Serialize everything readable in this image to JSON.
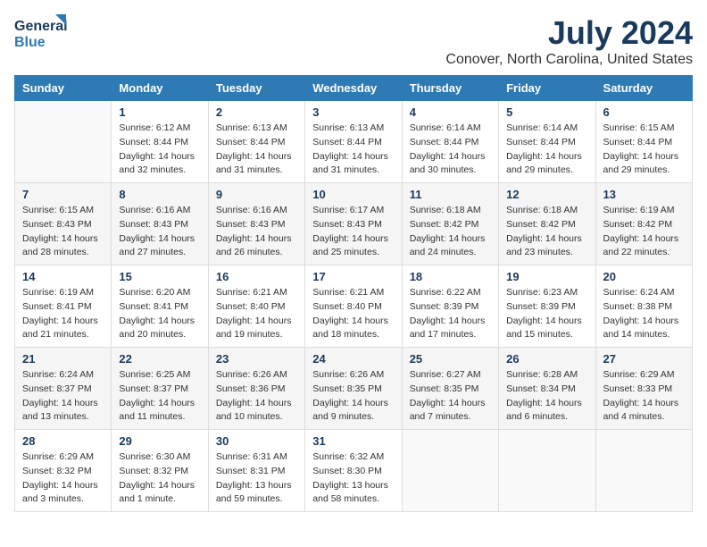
{
  "logo": {
    "line1": "General",
    "line2": "Blue"
  },
  "title": "July 2024",
  "subtitle": "Conover, North Carolina, United States",
  "days_header": [
    "Sunday",
    "Monday",
    "Tuesday",
    "Wednesday",
    "Thursday",
    "Friday",
    "Saturday"
  ],
  "weeks": [
    [
      {
        "day": "",
        "info": ""
      },
      {
        "day": "1",
        "info": "Sunrise: 6:12 AM\nSunset: 8:44 PM\nDaylight: 14 hours\nand 32 minutes."
      },
      {
        "day": "2",
        "info": "Sunrise: 6:13 AM\nSunset: 8:44 PM\nDaylight: 14 hours\nand 31 minutes."
      },
      {
        "day": "3",
        "info": "Sunrise: 6:13 AM\nSunset: 8:44 PM\nDaylight: 14 hours\nand 31 minutes."
      },
      {
        "day": "4",
        "info": "Sunrise: 6:14 AM\nSunset: 8:44 PM\nDaylight: 14 hours\nand 30 minutes."
      },
      {
        "day": "5",
        "info": "Sunrise: 6:14 AM\nSunset: 8:44 PM\nDaylight: 14 hours\nand 29 minutes."
      },
      {
        "day": "6",
        "info": "Sunrise: 6:15 AM\nSunset: 8:44 PM\nDaylight: 14 hours\nand 29 minutes."
      }
    ],
    [
      {
        "day": "7",
        "info": "Sunrise: 6:15 AM\nSunset: 8:43 PM\nDaylight: 14 hours\nand 28 minutes."
      },
      {
        "day": "8",
        "info": "Sunrise: 6:16 AM\nSunset: 8:43 PM\nDaylight: 14 hours\nand 27 minutes."
      },
      {
        "day": "9",
        "info": "Sunrise: 6:16 AM\nSunset: 8:43 PM\nDaylight: 14 hours\nand 26 minutes."
      },
      {
        "day": "10",
        "info": "Sunrise: 6:17 AM\nSunset: 8:43 PM\nDaylight: 14 hours\nand 25 minutes."
      },
      {
        "day": "11",
        "info": "Sunrise: 6:18 AM\nSunset: 8:42 PM\nDaylight: 14 hours\nand 24 minutes."
      },
      {
        "day": "12",
        "info": "Sunrise: 6:18 AM\nSunset: 8:42 PM\nDaylight: 14 hours\nand 23 minutes."
      },
      {
        "day": "13",
        "info": "Sunrise: 6:19 AM\nSunset: 8:42 PM\nDaylight: 14 hours\nand 22 minutes."
      }
    ],
    [
      {
        "day": "14",
        "info": "Sunrise: 6:19 AM\nSunset: 8:41 PM\nDaylight: 14 hours\nand 21 minutes."
      },
      {
        "day": "15",
        "info": "Sunrise: 6:20 AM\nSunset: 8:41 PM\nDaylight: 14 hours\nand 20 minutes."
      },
      {
        "day": "16",
        "info": "Sunrise: 6:21 AM\nSunset: 8:40 PM\nDaylight: 14 hours\nand 19 minutes."
      },
      {
        "day": "17",
        "info": "Sunrise: 6:21 AM\nSunset: 8:40 PM\nDaylight: 14 hours\nand 18 minutes."
      },
      {
        "day": "18",
        "info": "Sunrise: 6:22 AM\nSunset: 8:39 PM\nDaylight: 14 hours\nand 17 minutes."
      },
      {
        "day": "19",
        "info": "Sunrise: 6:23 AM\nSunset: 8:39 PM\nDaylight: 14 hours\nand 15 minutes."
      },
      {
        "day": "20",
        "info": "Sunrise: 6:24 AM\nSunset: 8:38 PM\nDaylight: 14 hours\nand 14 minutes."
      }
    ],
    [
      {
        "day": "21",
        "info": "Sunrise: 6:24 AM\nSunset: 8:37 PM\nDaylight: 14 hours\nand 13 minutes."
      },
      {
        "day": "22",
        "info": "Sunrise: 6:25 AM\nSunset: 8:37 PM\nDaylight: 14 hours\nand 11 minutes."
      },
      {
        "day": "23",
        "info": "Sunrise: 6:26 AM\nSunset: 8:36 PM\nDaylight: 14 hours\nand 10 minutes."
      },
      {
        "day": "24",
        "info": "Sunrise: 6:26 AM\nSunset: 8:35 PM\nDaylight: 14 hours\nand 9 minutes."
      },
      {
        "day": "25",
        "info": "Sunrise: 6:27 AM\nSunset: 8:35 PM\nDaylight: 14 hours\nand 7 minutes."
      },
      {
        "day": "26",
        "info": "Sunrise: 6:28 AM\nSunset: 8:34 PM\nDaylight: 14 hours\nand 6 minutes."
      },
      {
        "day": "27",
        "info": "Sunrise: 6:29 AM\nSunset: 8:33 PM\nDaylight: 14 hours\nand 4 minutes."
      }
    ],
    [
      {
        "day": "28",
        "info": "Sunrise: 6:29 AM\nSunset: 8:32 PM\nDaylight: 14 hours\nand 3 minutes."
      },
      {
        "day": "29",
        "info": "Sunrise: 6:30 AM\nSunset: 8:32 PM\nDaylight: 14 hours\nand 1 minute."
      },
      {
        "day": "30",
        "info": "Sunrise: 6:31 AM\nSunset: 8:31 PM\nDaylight: 13 hours\nand 59 minutes."
      },
      {
        "day": "31",
        "info": "Sunrise: 6:32 AM\nSunset: 8:30 PM\nDaylight: 13 hours\nand 58 minutes."
      },
      {
        "day": "",
        "info": ""
      },
      {
        "day": "",
        "info": ""
      },
      {
        "day": "",
        "info": ""
      }
    ]
  ]
}
